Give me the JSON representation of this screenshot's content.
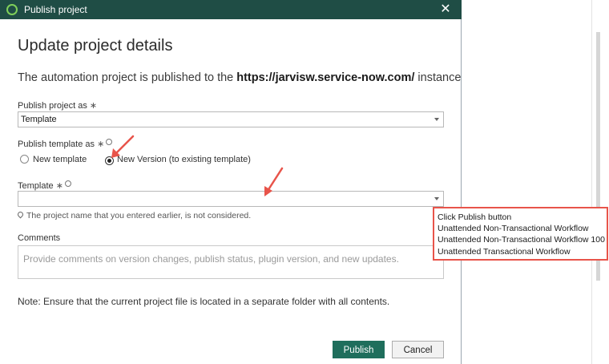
{
  "window": {
    "title": "Publish project"
  },
  "dialog": {
    "heading": "Update project details",
    "description_prefix": "The automation project is published to the ",
    "instance_url": "https://jarvisw.service-now.com/",
    "description_suffix": " instance",
    "publish_as": {
      "label": "Publish project as",
      "required_mark": "∗",
      "value": "Template"
    },
    "publish_template_as": {
      "label": "Publish template as",
      "required_mark": "∗",
      "options": [
        {
          "label": "New template",
          "checked": false
        },
        {
          "label": "New Version (to existing template)",
          "checked": true
        }
      ]
    },
    "template": {
      "label": "Template",
      "required_mark": "∗",
      "value": ""
    },
    "hint": "The project name that you entered earlier, is not considered.",
    "comments": {
      "label": "Comments",
      "placeholder": "Provide comments on version changes, publish status, plugin version, and new updates."
    },
    "note": "Note: Ensure that the current project file is located in a separate folder with all contents.",
    "buttons": {
      "publish": "Publish",
      "cancel": "Cancel"
    }
  },
  "callout": {
    "lines": [
      "Click Publish button",
      "Unattended Non-Transactional Workflow",
      "Unattended Non-Transactional Workflow 100",
      "Unattended Transactional Workflow"
    ]
  },
  "colors": {
    "titlebar": "#1f4d45",
    "publish_button": "#1f6e5c",
    "annotation": "#e8544a"
  }
}
